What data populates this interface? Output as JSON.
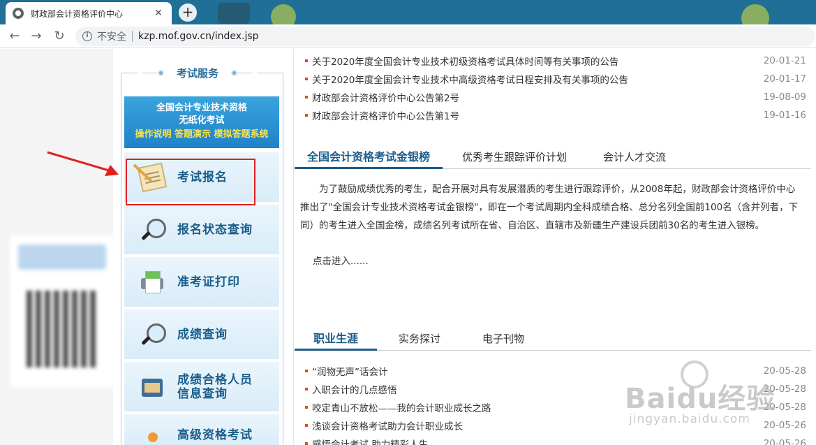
{
  "browser": {
    "tab_title": "财政部会计资格评价中心",
    "tab_close": "✕",
    "new_tab": "+",
    "security_label": "不安全",
    "url": "kzp.mof.gov.cn/index.jsp",
    "nav": {
      "back": "←",
      "forward": "→",
      "reload": "↻",
      "info": "i"
    }
  },
  "service": {
    "title": "考试服务",
    "banner": {
      "line1": "全国会计专业技术资格",
      "line2": "无纸化考试",
      "line3": "操作说明 答题演示 模拟答题系统"
    },
    "items": [
      {
        "label": "考试报名",
        "icon": "notepad-pencil-icon"
      },
      {
        "label": "报名状态查询",
        "icon": "magnifier-icon"
      },
      {
        "label": "准考证打印",
        "icon": "printer-icon"
      },
      {
        "label": "成绩查询",
        "icon": "magnifier-icon"
      },
      {
        "label": "成绩合格人员信息查询",
        "line1": "成绩合格人员",
        "line2": "信息查询",
        "icon": "folder-box-icon"
      },
      {
        "label": "高级资格考试",
        "icon": "pin-icon"
      }
    ]
  },
  "notices": [
    {
      "title": "关于2020年度全国会计专业技术初级资格考试具体时间等有关事项的公告",
      "date": "20-01-21"
    },
    {
      "title": "关于2020年度全国会计专业技术中高级资格考试日程安排及有关事项的公告",
      "date": "20-01-17"
    },
    {
      "title": "财政部会计资格评价中心公告第2号",
      "date": "19-08-09"
    },
    {
      "title": "财政部会计资格评价中心公告第1号",
      "date": "19-01-16"
    }
  ],
  "tabs1": {
    "items": [
      "全国会计资格考试金银榜",
      "优秀考生跟踪评价计划",
      "会计人才交流"
    ],
    "active": 0
  },
  "gold_list": {
    "paragraph": "为了鼓励成绩优秀的考生，配合开展对具有发展潜质的考生进行跟踪评价，从2008年起，财政部会计资格评价中心推出了\"全国会计专业技术资格考试金银榜\"，即在一个考试周期内全科成绩合格、总分名列全国前100名（含并列者，下同）的考生进入全国金榜，成绩名列考试所在省、自治区、直辖市及新疆生产建设兵团前30名的考生进入银榜。",
    "more": "点击进入......"
  },
  "tabs2": {
    "items": [
      "职业生涯",
      "实务探讨",
      "电子刊物"
    ],
    "active": 0
  },
  "career": [
    {
      "title": "“润物无声”话会计",
      "date": "20-05-28"
    },
    {
      "title": "入职会计的几点感悟",
      "date": "20-05-28"
    },
    {
      "title": "咬定青山不放松——我的会计职业成长之路",
      "date": "20-05-28"
    },
    {
      "title": "浅谈会计资格考试助力会计职业成长",
      "date": "20-05-26"
    },
    {
      "title": "感悟会计考试 助力精彩人生",
      "date": "20-05-26"
    }
  ],
  "watermark": {
    "brand": "Baidu经验",
    "site": "jingyan.baidu.com"
  },
  "colors": {
    "accent": "#1b5c8a",
    "banner": "#1f82c8",
    "highlight_box": "#e02020",
    "bullet": "#e04a1c"
  }
}
